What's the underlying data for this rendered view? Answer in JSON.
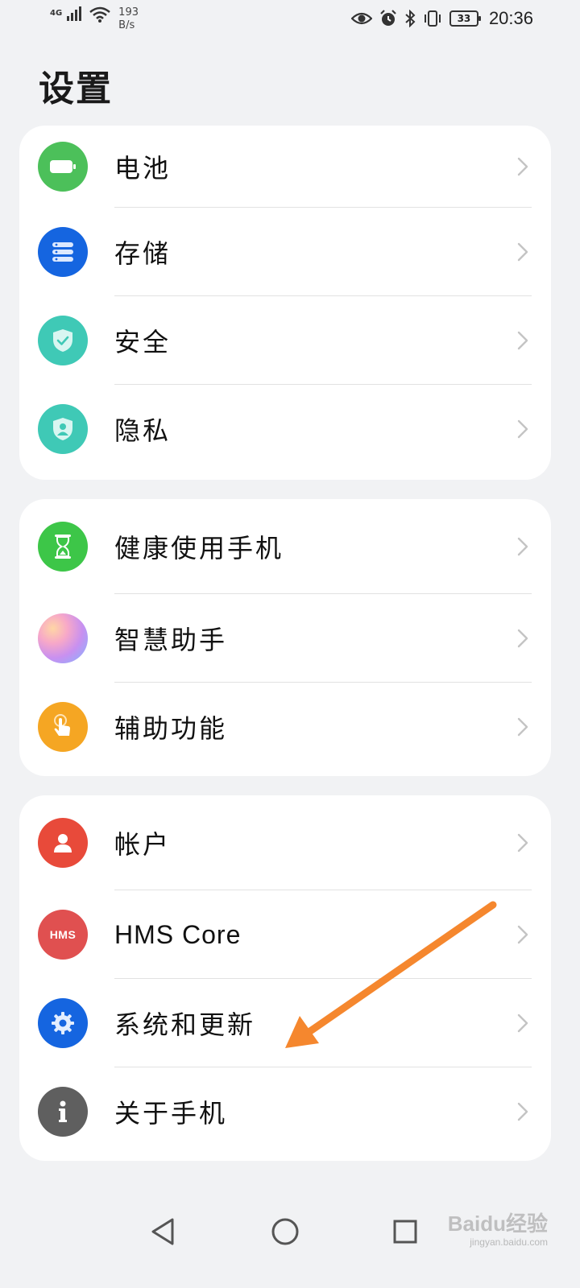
{
  "status_bar": {
    "network": "4G",
    "speed_value": "193",
    "speed_unit": "B/s",
    "battery_level": "33",
    "time": "20:36"
  },
  "page": {
    "title": "设置"
  },
  "groups": [
    {
      "items": [
        {
          "label": "电池",
          "icon": "battery-icon",
          "color": "#4cc05a"
        },
        {
          "label": "存储",
          "icon": "storage-icon",
          "color": "#1565e0"
        },
        {
          "label": "安全",
          "icon": "shield-check-icon",
          "color": "#3fc9b6"
        },
        {
          "label": "隐私",
          "icon": "privacy-shield-icon",
          "color": "#3fc9b6"
        }
      ]
    },
    {
      "items": [
        {
          "label": "健康使用手机",
          "icon": "hourglass-icon",
          "color": "#3dc648"
        },
        {
          "label": "智慧助手",
          "icon": "assistant-orb-icon",
          "color": "#c890f0"
        },
        {
          "label": "辅助功能",
          "icon": "hand-pointer-icon",
          "color": "#f5a623"
        }
      ]
    },
    {
      "items": [
        {
          "label": "帐户",
          "icon": "user-icon",
          "color": "#e84a3a"
        },
        {
          "label": "HMS Core",
          "icon": "hms-icon",
          "color": "#e05050"
        },
        {
          "label": "系统和更新",
          "icon": "gear-icon",
          "color": "#1565e0"
        },
        {
          "label": "关于手机",
          "icon": "info-icon",
          "color": "#5f5f5f"
        }
      ]
    }
  ],
  "hms_icon_text": "HMS",
  "annotation": {
    "arrow_color": "#f5872e"
  },
  "navigation": {
    "back": "back-icon",
    "home": "home-icon",
    "recent": "recent-apps-icon"
  },
  "watermark": {
    "brand": "Baidu经验",
    "url": "jingyan.baidu.com"
  }
}
